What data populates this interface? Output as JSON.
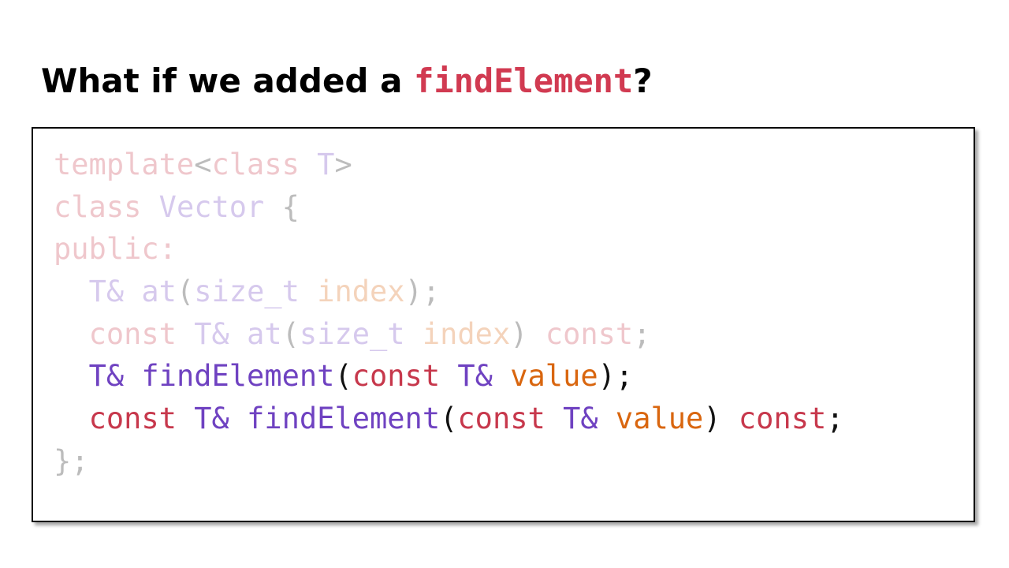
{
  "title": {
    "prefix": "What if we added a ",
    "highlight": "findElement",
    "suffix": "?"
  },
  "colors": {
    "keyword": "#c7384c",
    "type": "#6f42c1",
    "function": "#6f42c1",
    "parameter": "#d9660f",
    "punctuation": "#111111",
    "title_highlight": "#d13a51"
  },
  "code_lines": [
    {
      "faded": true,
      "tokens": [
        {
          "text": "template",
          "kind": "keyword"
        },
        {
          "text": "<",
          "kind": "punctuation"
        },
        {
          "text": "class",
          "kind": "keyword"
        },
        {
          "text": " ",
          "kind": "punctuation"
        },
        {
          "text": "T",
          "kind": "type"
        },
        {
          "text": ">",
          "kind": "punctuation"
        }
      ]
    },
    {
      "faded": true,
      "tokens": [
        {
          "text": "class",
          "kind": "keyword"
        },
        {
          "text": " ",
          "kind": "punctuation"
        },
        {
          "text": "Vector",
          "kind": "type"
        },
        {
          "text": " {",
          "kind": "punctuation"
        }
      ]
    },
    {
      "faded": true,
      "tokens": [
        {
          "text": "public:",
          "kind": "keyword"
        }
      ]
    },
    {
      "faded": true,
      "tokens": [
        {
          "text": "  ",
          "kind": "punctuation"
        },
        {
          "text": "T&",
          "kind": "type"
        },
        {
          "text": " ",
          "kind": "punctuation"
        },
        {
          "text": "at",
          "kind": "function"
        },
        {
          "text": "(",
          "kind": "punctuation"
        },
        {
          "text": "size_t",
          "kind": "type"
        },
        {
          "text": " ",
          "kind": "punctuation"
        },
        {
          "text": "index",
          "kind": "parameter"
        },
        {
          "text": ");",
          "kind": "punctuation"
        }
      ]
    },
    {
      "faded": true,
      "tokens": [
        {
          "text": "  ",
          "kind": "punctuation"
        },
        {
          "text": "const",
          "kind": "keyword"
        },
        {
          "text": " ",
          "kind": "punctuation"
        },
        {
          "text": "T&",
          "kind": "type"
        },
        {
          "text": " ",
          "kind": "punctuation"
        },
        {
          "text": "at",
          "kind": "function"
        },
        {
          "text": "(",
          "kind": "punctuation"
        },
        {
          "text": "size_t",
          "kind": "type"
        },
        {
          "text": " ",
          "kind": "punctuation"
        },
        {
          "text": "index",
          "kind": "parameter"
        },
        {
          "text": ") ",
          "kind": "punctuation"
        },
        {
          "text": "const",
          "kind": "keyword"
        },
        {
          "text": ";",
          "kind": "punctuation"
        }
      ]
    },
    {
      "faded": false,
      "tokens": [
        {
          "text": "  ",
          "kind": "punctuation"
        },
        {
          "text": "T&",
          "kind": "type"
        },
        {
          "text": " ",
          "kind": "punctuation"
        },
        {
          "text": "findElement",
          "kind": "function"
        },
        {
          "text": "(",
          "kind": "punctuation"
        },
        {
          "text": "const",
          "kind": "keyword"
        },
        {
          "text": " ",
          "kind": "punctuation"
        },
        {
          "text": "T&",
          "kind": "type"
        },
        {
          "text": " ",
          "kind": "punctuation"
        },
        {
          "text": "value",
          "kind": "parameter"
        },
        {
          "text": ");",
          "kind": "punctuation"
        }
      ]
    },
    {
      "faded": false,
      "tokens": [
        {
          "text": "  ",
          "kind": "punctuation"
        },
        {
          "text": "const",
          "kind": "keyword"
        },
        {
          "text": " ",
          "kind": "punctuation"
        },
        {
          "text": "T&",
          "kind": "type"
        },
        {
          "text": " ",
          "kind": "punctuation"
        },
        {
          "text": "findElement",
          "kind": "function"
        },
        {
          "text": "(",
          "kind": "punctuation"
        },
        {
          "text": "const",
          "kind": "keyword"
        },
        {
          "text": " ",
          "kind": "punctuation"
        },
        {
          "text": "T&",
          "kind": "type"
        },
        {
          "text": " ",
          "kind": "punctuation"
        },
        {
          "text": "value",
          "kind": "parameter"
        },
        {
          "text": ") ",
          "kind": "punctuation"
        },
        {
          "text": "const",
          "kind": "keyword"
        },
        {
          "text": ";",
          "kind": "punctuation"
        }
      ]
    },
    {
      "faded": true,
      "tokens": [
        {
          "text": "};",
          "kind": "punctuation"
        }
      ]
    }
  ]
}
